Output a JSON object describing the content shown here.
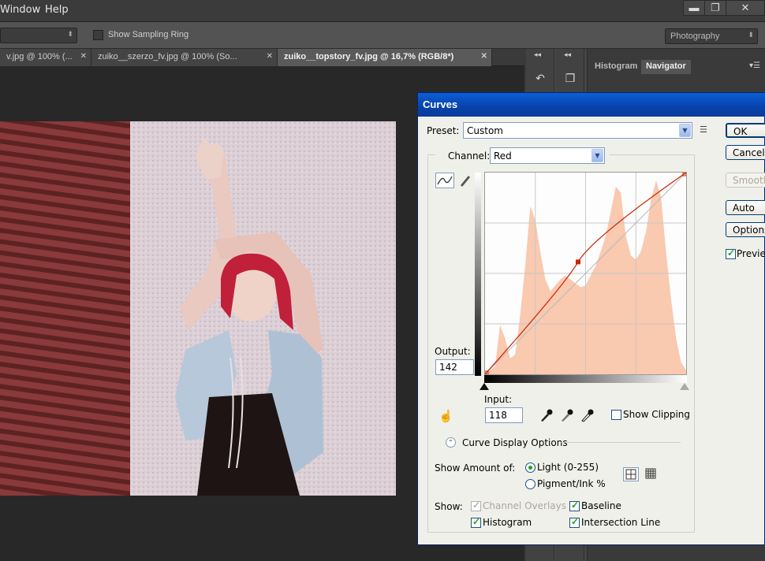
{
  "menubar": {
    "items": [
      "Window",
      "Help"
    ],
    "window_buttons": [
      "▬",
      "❐",
      "✕"
    ]
  },
  "options_bar": {
    "sample_size": "",
    "show_sampling_ring": "Show Sampling Ring",
    "workspace": "Photography"
  },
  "doc_tabs": [
    {
      "label": "v.jpg @ 100% (..."
    },
    {
      "label": "zuiko__szerzo_fv.jpg @ 100% (So..."
    },
    {
      "label": "zuiko__topstory_fv.jpg @ 16,7% (RGB/8*)"
    }
  ],
  "panel": {
    "tabs": [
      "Histogram",
      "Navigator"
    ],
    "collapse": "◂◂"
  },
  "curves": {
    "title": "Curves",
    "preset_label": "Preset:",
    "preset_value": "Custom",
    "channel_label": "Channel:",
    "channel_value": "Red",
    "output_label": "Output:",
    "output_value": "142",
    "input_label": "Input:",
    "input_value": "118",
    "show_clipping": "Show Clipping",
    "curve_display_options": "Curve Display Options",
    "show_amount_label": "Show Amount of:",
    "light_label": "Light  (0-255)",
    "pigment_label": "Pigment/Ink %",
    "show_label": "Show:",
    "channel_overlays": "Channel Overlays",
    "baseline": "Baseline",
    "histogram": "Histogram",
    "intersection_line": "Intersection Line",
    "buttons": {
      "ok": "OK",
      "cancel": "Cancel",
      "smooth": "Smooth",
      "auto": "Auto",
      "options": "Options...",
      "preview": "Preview"
    },
    "colors": {
      "histogram_fill": "#f9c9b0",
      "curve": "#cc2200"
    }
  }
}
